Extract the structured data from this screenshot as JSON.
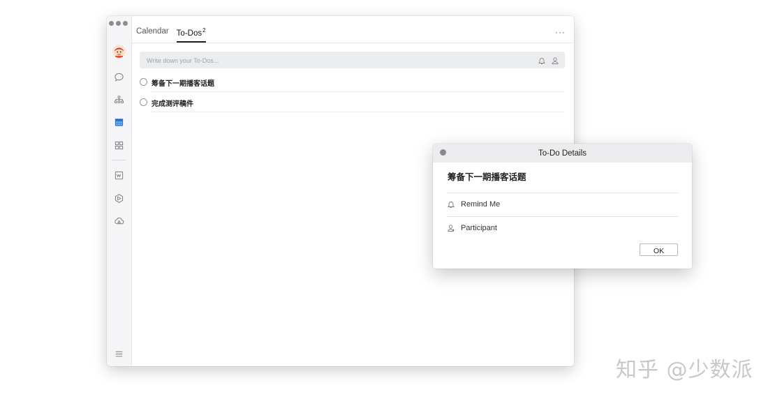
{
  "tabs": [
    {
      "label": "Calendar",
      "active": false
    },
    {
      "label": "To-Dos",
      "badge": "2",
      "active": true
    }
  ],
  "more_icon": "ellipsis-icon",
  "input": {
    "placeholder": "Write down your To-Dos..."
  },
  "todos": [
    {
      "text": "筹备下一期播客话题",
      "done": false
    },
    {
      "text": "完成测评稿件",
      "done": false
    }
  ],
  "sidebar_icons": [
    "avatar",
    "chat-icon",
    "org-chart-icon",
    "calendar-icon",
    "apps-grid-icon",
    "docs-icon",
    "hexagon-icon",
    "cloud-icon",
    "menu-icon"
  ],
  "dialog": {
    "title": "To-Do Details",
    "task_title": "筹备下一期播客话题",
    "remind_label": "Remind Me",
    "participant_label": "Participant",
    "ok_label": "OK"
  },
  "colors": {
    "accent": "#2d7ee6",
    "sidebar_bg": "#f5f5f7",
    "input_bg": "#ebecee"
  },
  "watermark": "知乎 @少数派"
}
